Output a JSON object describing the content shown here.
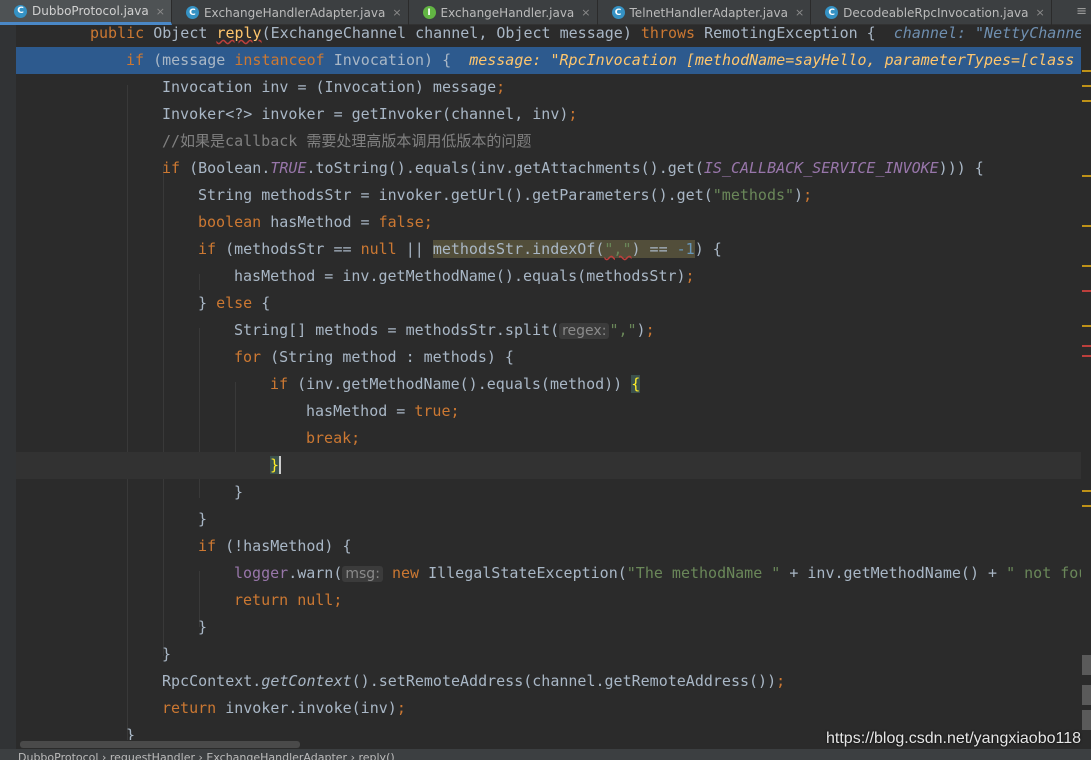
{
  "tabs": [
    {
      "label": "DubboProtocol.java",
      "icon": "C",
      "active": true
    },
    {
      "label": "ExchangeHandlerAdapter.java",
      "icon": "C"
    },
    {
      "label": "ExchangeHandler.java",
      "icon": "I"
    },
    {
      "label": "TelnetHandlerAdapter.java",
      "icon": "C"
    },
    {
      "label": "DecodeableRpcInvocation.java",
      "icon": "C"
    }
  ],
  "tab_close_glyph": "×",
  "tab_menu_glyph": "≡",
  "code": {
    "l0": {
      "a": "public",
      "b": " Object ",
      "c": "reply",
      "d": "(ExchangeChannel channel, Object message) ",
      "e": "throws",
      "f": " RemotingException {  ",
      "g": "channel: \"NettyChannel"
    },
    "l1": {
      "a": "if",
      "b": " (message ",
      "c": "instanceof",
      "d": " Invocation) {  ",
      "e": "message: \"RpcInvocation [methodName=sayHello, parameterTypes=[class j"
    },
    "l2": {
      "a": "Invocation inv = (Invocation) message",
      "b": ";"
    },
    "l3": {
      "a": "Invoker<?> invoker = getInvoker(channel, inv)",
      "b": ";"
    },
    "l4": {
      "a": "//如果是callback 需要处理高版本调用低版本的问题"
    },
    "l5": {
      "a": "if",
      "b": " (Boolean.",
      "c": "TRUE",
      "d": ".toString().equals(inv.getAttachments().get(",
      "e": "IS_CALLBACK_SERVICE_INVOKE",
      "f": "))) {"
    },
    "l6": {
      "a": "String methodsStr = invoker.getUrl().getParameters().get(",
      "b": "\"methods\"",
      "c": ")",
      "d": ";"
    },
    "l7": {
      "a": "boolean",
      "b": " hasMethod = ",
      "c": "false",
      "d": ";"
    },
    "l8": {
      "a": "if",
      "b": " (methodsStr == ",
      "c": "null",
      "d": " || ",
      "e": "methodsStr.indexOf(",
      "f": "\",\"",
      "g": ") == ",
      "h": "-1",
      "i": ") {"
    },
    "l9": {
      "a": "hasMethod = inv.getMethodName().equals(methodsStr)",
      "b": ";"
    },
    "l10": {
      "a": "} ",
      "b": "else",
      "c": " {"
    },
    "l11": {
      "a": "String[] methods = methodsStr.split(",
      "b": "regex:",
      "c": "\",\"",
      "d": ")",
      "e": ";"
    },
    "l12": {
      "a": "for",
      "b": " (String method : methods) {"
    },
    "l13": {
      "a": "if",
      "b": " (inv.getMethodName().equals(method)) ",
      "c": "{"
    },
    "l14": {
      "a": "hasMethod = ",
      "b": "true",
      "c": ";"
    },
    "l15": {
      "a": "break",
      "b": ";"
    },
    "l16": {
      "a": "}"
    },
    "l17": {
      "a": "}"
    },
    "l18": {
      "a": "}"
    },
    "l19": {
      "a": "if",
      "b": " (!hasMethod) {"
    },
    "l20": {
      "a": "logger",
      "b": ".warn(",
      "c": "msg:",
      "d": " ",
      "e": "new",
      "f": " IllegalStateException(",
      "g": "\"The methodName \"",
      "h": " + inv.getMethodName() + ",
      "i": "\" not found"
    },
    "l21": {
      "a": "return",
      "b": " ",
      "c": "null",
      "d": ";"
    },
    "l22": {
      "a": "}"
    },
    "l23": {
      "a": "}"
    },
    "l24": {
      "a": "RpcContext.",
      "b": "getContext",
      "c": "().setRemoteAddress(channel.getRemoteAddress())",
      "d": ";"
    },
    "l25": {
      "a": "return",
      "b": " invoker.invoke(inv)",
      "c": ";"
    },
    "l26": {
      "a": "}"
    }
  },
  "watermark": "https://blog.csdn.net/yangxiaobo118",
  "breadcrumbs": "DubboProtocol  ›  requestHandler  ›  ExchangeHandlerAdapter  ›  reply()"
}
